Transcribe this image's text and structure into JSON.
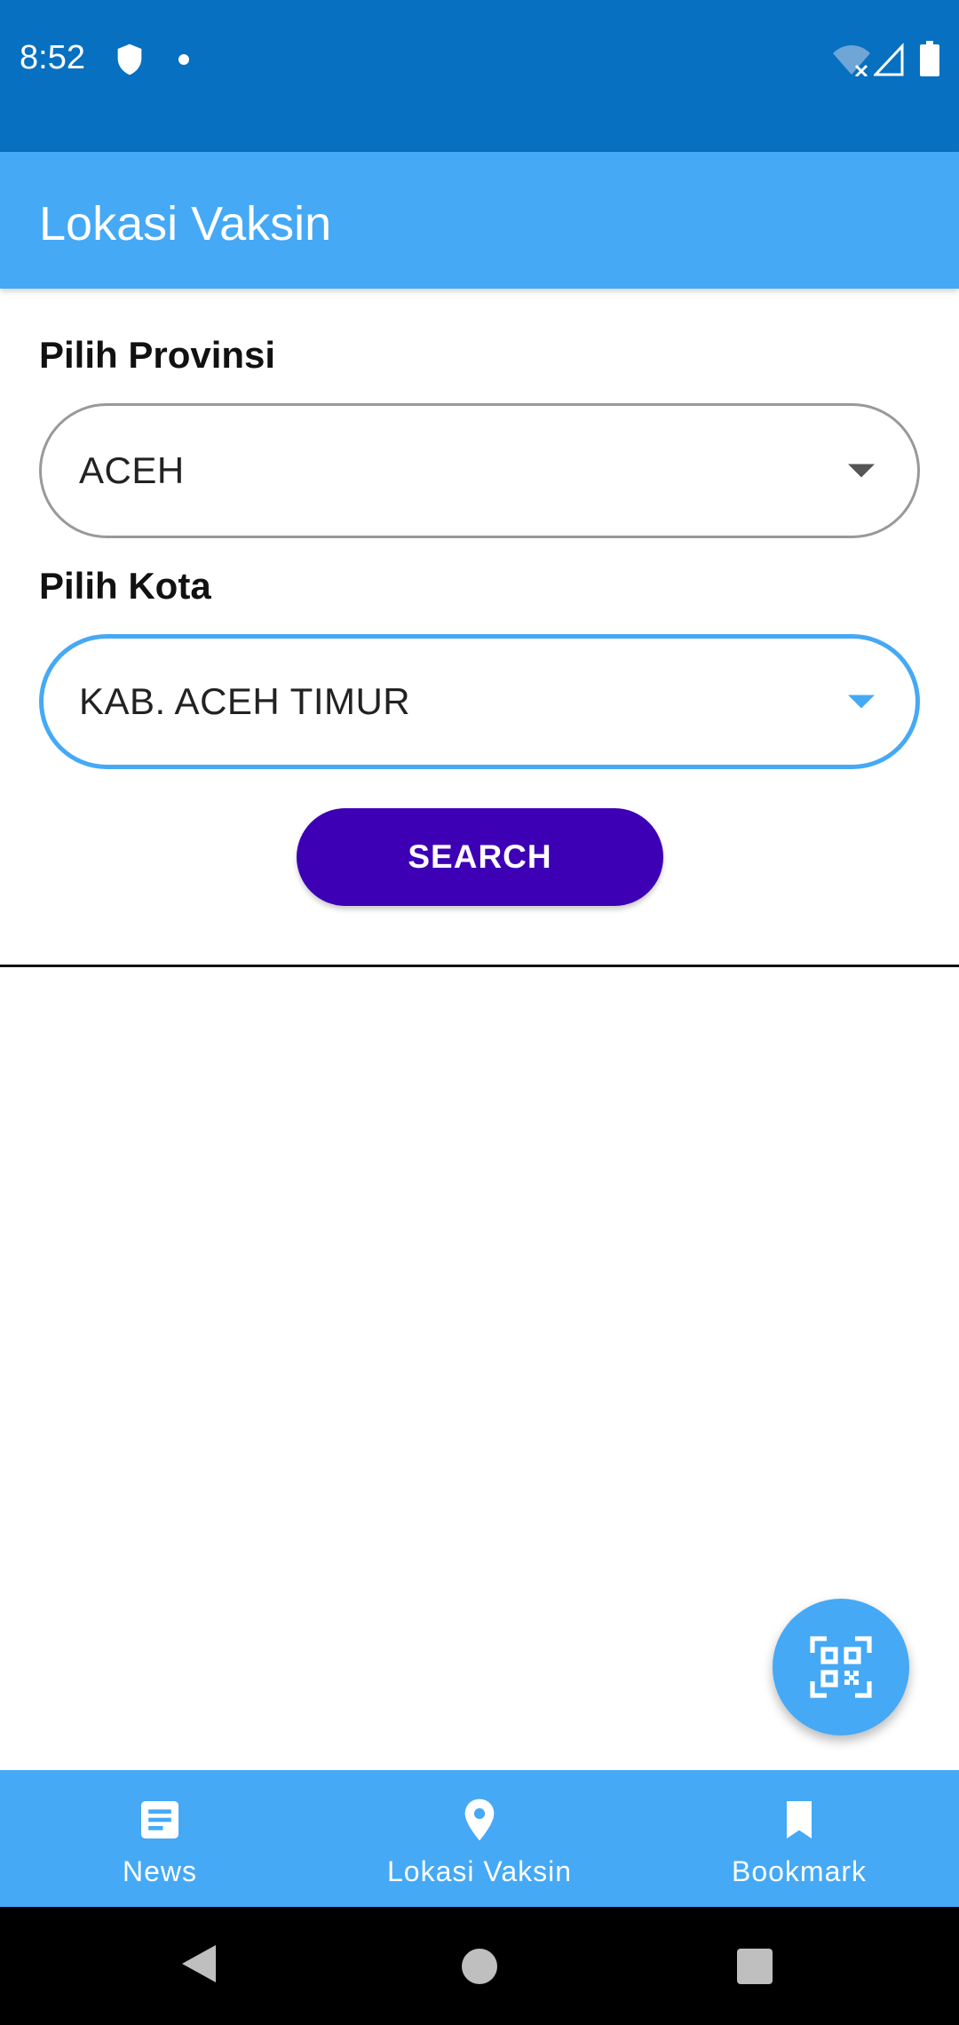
{
  "status_bar": {
    "time": "8:52",
    "icons": [
      "shield-icon",
      "notification-dot-icon",
      "wifi-off-icon",
      "signal-icon",
      "battery-icon"
    ]
  },
  "app_bar": {
    "title": "Lokasi Vaksin",
    "color": "#45a9f5"
  },
  "form": {
    "province_label": "Pilih Provinsi",
    "province_value": "ACEH",
    "city_label": "Pilih Kota",
    "city_value": "KAB. ACEH TIMUR",
    "search_label": "SEARCH",
    "search_color": "#3d00b4",
    "focus_color": "#45a9f5"
  },
  "fab": {
    "icon": "qr-code-scan-icon"
  },
  "bottom_nav": {
    "items": [
      {
        "label": "News",
        "icon": "article-icon"
      },
      {
        "label": "Lokasi Vaksin",
        "icon": "location-pin-icon"
      },
      {
        "label": "Bookmark",
        "icon": "bookmark-icon"
      }
    ]
  },
  "system_nav": {
    "icons": [
      "back-icon",
      "home-icon",
      "recents-icon"
    ]
  }
}
